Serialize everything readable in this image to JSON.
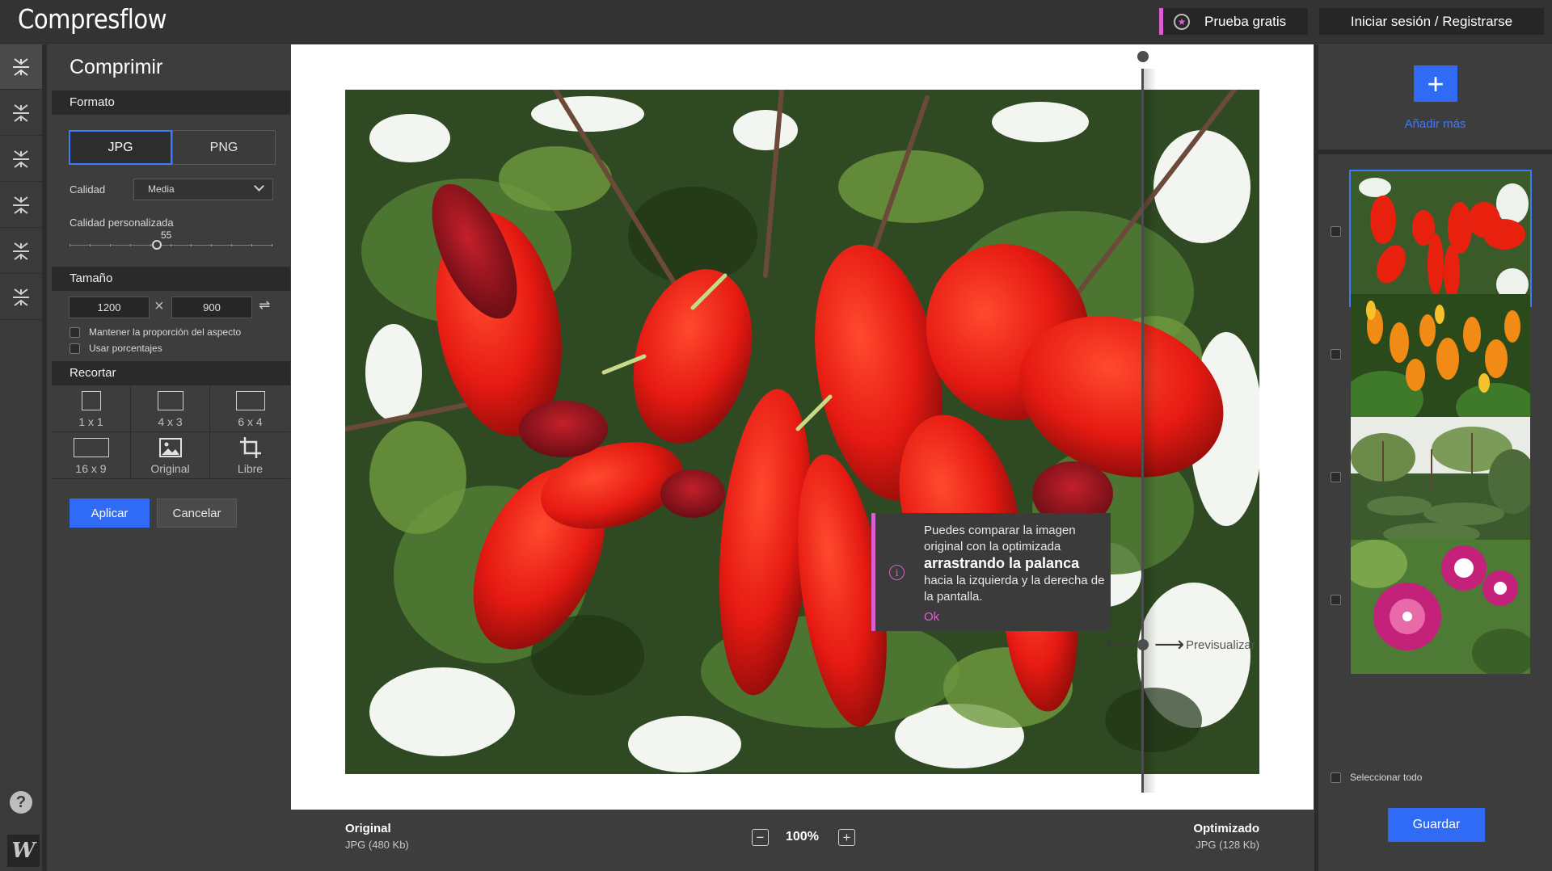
{
  "app": {
    "name": "Compresflow"
  },
  "header": {
    "trial_label": "Prueba gratis",
    "login_label": "Iniciar sesión / Registrarse",
    "trial_icon": "star-icon"
  },
  "rail": {
    "items": [
      {
        "icon": "compress-icon",
        "active": true
      },
      {
        "icon": "compress-icon"
      },
      {
        "icon": "compress-icon"
      },
      {
        "icon": "compress-icon"
      },
      {
        "icon": "compress-icon"
      },
      {
        "icon": "compress-icon"
      }
    ],
    "help": "?",
    "brand": "W"
  },
  "panel": {
    "title": "Comprimir",
    "format": {
      "heading": "Formato",
      "options": [
        "JPG",
        "PNG"
      ],
      "selected": "JPG",
      "quality_label": "Calidad",
      "quality_value": "Media",
      "custom_quality_label": "Calidad personalizada",
      "custom_quality_value": "55"
    },
    "size": {
      "heading": "Tamaño",
      "width": "1200",
      "height": "900",
      "keep_ratio_label": "Mantener la proporción del aspecto",
      "use_percent_label": "Usar porcentajes"
    },
    "crop": {
      "heading": "Recortar",
      "options": [
        "1 x 1",
        "4 x 3",
        "6 x 4",
        "16 x 9",
        "Original",
        "Libre"
      ]
    },
    "apply_label": "Aplicar",
    "cancel_label": "Cancelar"
  },
  "canvas": {
    "preview_label": "Previsualizar",
    "tooltip": {
      "line1": "Puedes comparar la imagen original con la optimizada",
      "bold": "arrastrando la palanca",
      "line2": "hacia la izquierda y la derecha de la pantalla.",
      "ok": "Ok"
    }
  },
  "status": {
    "original_title": "Original",
    "original_info": "JPG (480 Kb)",
    "zoom": "100%",
    "optimized_title": "Optimizado",
    "optimized_info": "JPG (128 Kb)"
  },
  "right": {
    "add_label": "Añadir más",
    "select_all_label": "Seleccionar todo",
    "save_label": "Guardar"
  },
  "colors": {
    "accent": "#2f6bf5",
    "highlight": "#d95fd0",
    "panel_bg": "#3d3d3d",
    "header_bg": "#333333"
  }
}
